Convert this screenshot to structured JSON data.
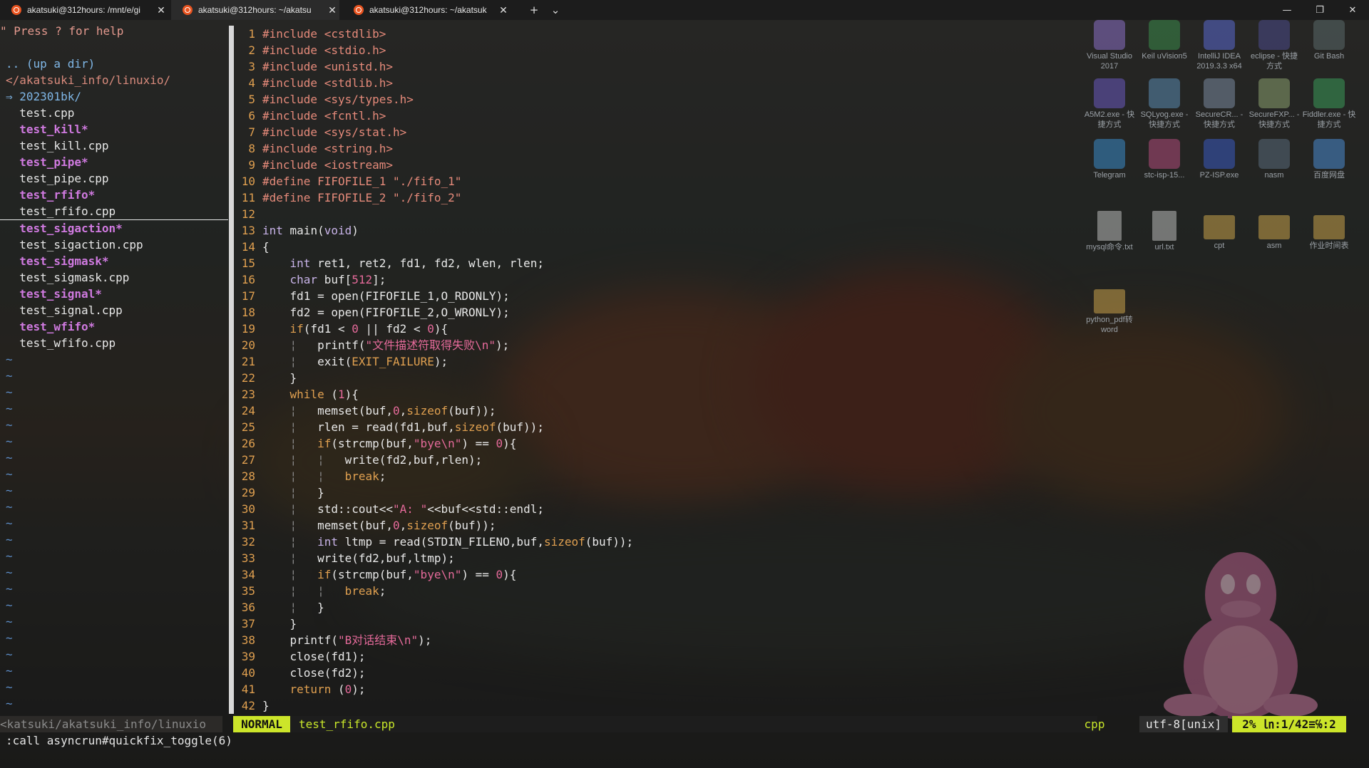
{
  "tabs": [
    {
      "title": "akatsuki@312hours: /mnt/e/gi"
    },
    {
      "title": "akatsuki@312hours: ~/akatsu"
    },
    {
      "title": "akatsuki@312hours: ~/akatsuk"
    }
  ],
  "titlebar": {
    "new_tab": "+",
    "dropdown": "⌄",
    "min": "—",
    "max": "❐",
    "close": "✕"
  },
  "desktop": [
    {
      "label": "Visual Studio 2017",
      "icon": "visual-studio-icon",
      "color": "#8b6fc7"
    },
    {
      "label": "Keil uVision5",
      "icon": "keil-icon",
      "color": "#3a8a4a"
    },
    {
      "label": "IntelliJ IDEA 2019.3.3 x64",
      "icon": "intellij-icon",
      "color": "#5a6ad0"
    },
    {
      "label": "eclipse - 快捷方式",
      "icon": "eclipse-icon",
      "color": "#4b4a8a"
    },
    {
      "label": "Git Bash",
      "icon": "git-bash-icon",
      "color": "#5a6a6a"
    },
    {
      "label": "A5M2.exe - 快捷方式",
      "icon": "a5m2-icon",
      "color": "#6a5ac0"
    },
    {
      "label": "SQLyog.exe - 快捷方式",
      "icon": "sqlyog-icon",
      "color": "#5a8ab0"
    },
    {
      "label": "SecureCR... - 快捷方式",
      "icon": "securecrt-icon",
      "color": "#7a8aa0"
    },
    {
      "label": "SecureFXP... - 快捷方式",
      "icon": "securefx-icon",
      "color": "#8aa070"
    },
    {
      "label": "Fiddler.exe - 快捷方式",
      "icon": "fiddler-icon",
      "color": "#3a9a5a"
    },
    {
      "label": "Telegram",
      "icon": "telegram-icon",
      "color": "#3a8ac8"
    },
    {
      "label": "stc-isp-15...",
      "icon": "stc-isp-icon",
      "color": "#b04a7a"
    },
    {
      "label": "PZ-ISP.exe",
      "icon": "pz-isp-icon",
      "color": "#3a5ac0"
    },
    {
      "label": "nasm",
      "icon": "nasm-icon",
      "color": "#5a6a7a"
    },
    {
      "label": "百度网盘",
      "icon": "baidu-netdisk-icon",
      "color": "#4a8ad0"
    },
    {
      "label": "mysql命令.txt",
      "icon": "text-file-icon",
      "color": "#b9b9b9"
    },
    {
      "label": "url.txt",
      "icon": "text-file-icon",
      "color": "#b9b9b9"
    },
    {
      "label": "cpt",
      "icon": "folder-icon",
      "color": "#c9a24a"
    },
    {
      "label": "asm",
      "icon": "folder-icon",
      "color": "#c9a24a"
    },
    {
      "label": "作业时间表",
      "icon": "folder-icon",
      "color": "#c9a24a"
    },
    {
      "label": "python_pdf转word",
      "icon": "folder-icon",
      "color": "#c9a24a"
    }
  ],
  "nerdtree": {
    "help": "\" Press ? for help",
    "updir": ".. (up a dir)",
    "cwd": "</akatsuki_info/linuxio/",
    "items": [
      {
        "text": "⇒ 202301bk/",
        "kind": "dir"
      },
      {
        "text": "  test.cpp",
        "kind": "file"
      },
      {
        "text": "  test_kill*",
        "kind": "exe"
      },
      {
        "text": "  test_kill.cpp",
        "kind": "file"
      },
      {
        "text": "  test_pipe*",
        "kind": "exe"
      },
      {
        "text": "  test_pipe.cpp",
        "kind": "file"
      },
      {
        "text": "  test_rfifo*",
        "kind": "exe"
      },
      {
        "text": "  test_rfifo.cpp",
        "kind": "file"
      },
      {
        "text": "  test_sigaction*",
        "kind": "exe"
      },
      {
        "text": "  test_sigaction.cpp",
        "kind": "file"
      },
      {
        "text": "  test_sigmask*",
        "kind": "exe"
      },
      {
        "text": "  test_sigmask.cpp",
        "kind": "file"
      },
      {
        "text": "  test_signal*",
        "kind": "exe"
      },
      {
        "text": "  test_signal.cpp",
        "kind": "file"
      },
      {
        "text": "  test_wfifo*",
        "kind": "exe"
      },
      {
        "text": "  test_wfifo.cpp",
        "kind": "file"
      }
    ],
    "tilde_count": 22
  },
  "code": [
    [
      [
        "pp",
        "#include <cstdlib>"
      ]
    ],
    [
      [
        "pp",
        "#include <stdio.h>"
      ]
    ],
    [
      [
        "pp",
        "#include <unistd.h>"
      ]
    ],
    [
      [
        "pp",
        "#include <stdlib.h>"
      ]
    ],
    [
      [
        "pp",
        "#include <sys/types.h>"
      ]
    ],
    [
      [
        "pp",
        "#include <fcntl.h>"
      ]
    ],
    [
      [
        "pp",
        "#include <sys/stat.h>"
      ]
    ],
    [
      [
        "pp",
        "#include <string.h>"
      ]
    ],
    [
      [
        "pp",
        "#include <iostream>"
      ]
    ],
    [
      [
        "pp",
        "#define FIFOFILE_1 \"./fifo_1\""
      ]
    ],
    [
      [
        "pp",
        "#define FIFOFILE_2 \"./fifo_2\""
      ]
    ],
    [],
    [
      [
        "ty",
        "int"
      ],
      [
        "t",
        " main("
      ],
      [
        "ty",
        "void"
      ],
      [
        "t",
        ")"
      ]
    ],
    [
      [
        "t",
        "{"
      ]
    ],
    [
      [
        "t",
        "    "
      ],
      [
        "ty",
        "int"
      ],
      [
        "t",
        " ret1, ret2, fd1, fd2, wlen, rlen;"
      ]
    ],
    [
      [
        "t",
        "    "
      ],
      [
        "ty",
        "char"
      ],
      [
        "t",
        " buf["
      ],
      [
        "num",
        "512"
      ],
      [
        "t",
        "];"
      ]
    ],
    [
      [
        "t",
        "    fd1 = open(FIFOFILE_1,O_RDONLY);"
      ]
    ],
    [
      [
        "t",
        "    fd2 = open(FIFOFILE_2,O_WRONLY);"
      ]
    ],
    [
      [
        "t",
        "    "
      ],
      [
        "kw",
        "if"
      ],
      [
        "t",
        "(fd1 < "
      ],
      [
        "num",
        "0"
      ],
      [
        "t",
        " || fd2 < "
      ],
      [
        "num",
        "0"
      ],
      [
        "t",
        "){"
      ]
    ],
    [
      [
        "g",
        "    ¦   "
      ],
      [
        "t",
        "printf("
      ],
      [
        "str",
        "\"文件描述符取得失败\\n\""
      ],
      [
        "t",
        ");"
      ]
    ],
    [
      [
        "g",
        "    ¦   "
      ],
      [
        "t",
        "exit("
      ],
      [
        "kw",
        "EXIT_FAILURE"
      ],
      [
        "t",
        ");"
      ]
    ],
    [
      [
        "t",
        "    }"
      ]
    ],
    [
      [
        "t",
        "    "
      ],
      [
        "kw",
        "while"
      ],
      [
        "t",
        " ("
      ],
      [
        "num",
        "1"
      ],
      [
        "t",
        "){"
      ]
    ],
    [
      [
        "g",
        "    ¦   "
      ],
      [
        "t",
        "memset(buf,"
      ],
      [
        "num",
        "0"
      ],
      [
        "t",
        ","
      ],
      [
        "kw",
        "sizeof"
      ],
      [
        "t",
        "(buf));"
      ]
    ],
    [
      [
        "g",
        "    ¦   "
      ],
      [
        "t",
        "rlen = read(fd1,buf,"
      ],
      [
        "kw",
        "sizeof"
      ],
      [
        "t",
        "(buf));"
      ]
    ],
    [
      [
        "g",
        "    ¦   "
      ],
      [
        "kw",
        "if"
      ],
      [
        "t",
        "(strcmp(buf,"
      ],
      [
        "str",
        "\"bye\\n\""
      ],
      [
        "t",
        ") == "
      ],
      [
        "num",
        "0"
      ],
      [
        "t",
        "){"
      ]
    ],
    [
      [
        "g",
        "    ¦   ¦   "
      ],
      [
        "t",
        "write(fd2,buf,rlen);"
      ]
    ],
    [
      [
        "g",
        "    ¦   ¦   "
      ],
      [
        "kw",
        "break"
      ],
      [
        "t",
        ";"
      ]
    ],
    [
      [
        "g",
        "    ¦   "
      ],
      [
        "t",
        "}"
      ]
    ],
    [
      [
        "g",
        "    ¦   "
      ],
      [
        "t",
        "std::cout<<"
      ],
      [
        "str",
        "\"A: \""
      ],
      [
        "t",
        "<<buf<<std::endl;"
      ]
    ],
    [
      [
        "g",
        "    ¦   "
      ],
      [
        "t",
        "memset(buf,"
      ],
      [
        "num",
        "0"
      ],
      [
        "t",
        ","
      ],
      [
        "kw",
        "sizeof"
      ],
      [
        "t",
        "(buf));"
      ]
    ],
    [
      [
        "g",
        "    ¦   "
      ],
      [
        "ty",
        "int"
      ],
      [
        "t",
        " ltmp = read(STDIN_FILENO,buf,"
      ],
      [
        "kw",
        "sizeof"
      ],
      [
        "t",
        "(buf));"
      ]
    ],
    [
      [
        "g",
        "    ¦   "
      ],
      [
        "t",
        "write(fd2,buf,ltmp);"
      ]
    ],
    [
      [
        "g",
        "    ¦   "
      ],
      [
        "kw",
        "if"
      ],
      [
        "t",
        "(strcmp(buf,"
      ],
      [
        "str",
        "\"bye\\n\""
      ],
      [
        "t",
        ") == "
      ],
      [
        "num",
        "0"
      ],
      [
        "t",
        "){"
      ]
    ],
    [
      [
        "g",
        "    ¦   ¦   "
      ],
      [
        "kw",
        "break"
      ],
      [
        "t",
        ";"
      ]
    ],
    [
      [
        "g",
        "    ¦   "
      ],
      [
        "t",
        "}"
      ]
    ],
    [
      [
        "t",
        "    }"
      ]
    ],
    [
      [
        "t",
        "    printf("
      ],
      [
        "str",
        "\"B对话结束\\n\""
      ],
      [
        "t",
        ");"
      ]
    ],
    [
      [
        "t",
        "    close(fd1);"
      ]
    ],
    [
      [
        "t",
        "    close(fd2);"
      ]
    ],
    [
      [
        "t",
        "    "
      ],
      [
        "kw",
        "return"
      ],
      [
        "t",
        " ("
      ],
      [
        "num",
        "0"
      ],
      [
        "t",
        ");"
      ]
    ],
    [
      [
        "t",
        "}"
      ]
    ]
  ],
  "statusline": {
    "left": "<katsuki/akatsuki_info/linuxio",
    "mode": "NORMAL",
    "file": "test_rfifo.cpp",
    "filetype": "cpp",
    "encoding": "utf-8[unix]",
    "position": "2% ㏑:1/42≡℅:2"
  },
  "cmdline": ":call asyncrun#quickfix_toggle(6)"
}
